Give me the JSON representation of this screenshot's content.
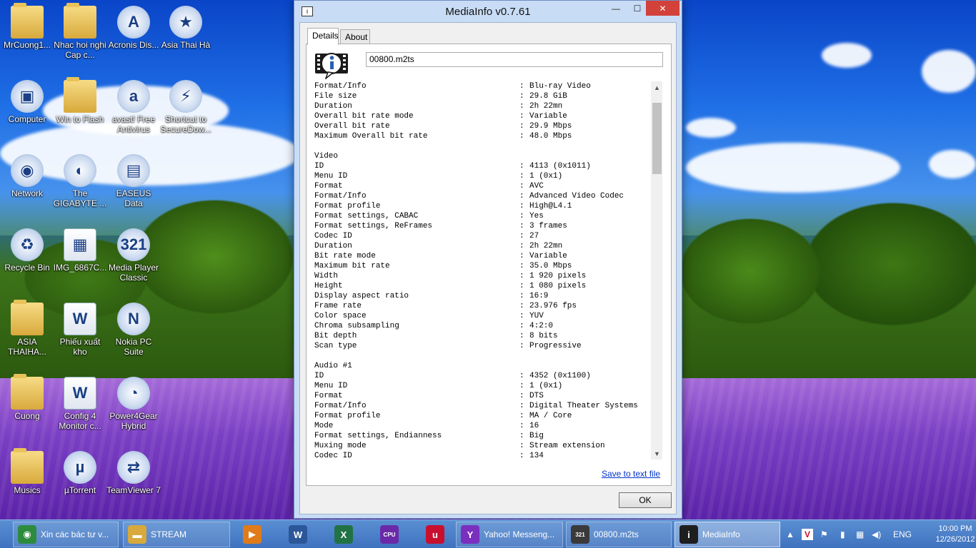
{
  "window": {
    "title": "MediaInfo v0.7.61",
    "tabs": [
      {
        "label": "Details"
      },
      {
        "label": "About"
      }
    ],
    "filename": "00800.m2ts",
    "save_link": "Save to text file",
    "ok_label": "OK",
    "controls": {
      "minimize": "—",
      "maximize": "☐",
      "close": "✕"
    }
  },
  "info": [
    {
      "k": "Format/Info",
      "v": "Blu-ray Video"
    },
    {
      "k": "File size",
      "v": "29.8 GiB"
    },
    {
      "k": "Duration",
      "v": "2h 22mn"
    },
    {
      "k": "Overall bit rate mode",
      "v": "Variable"
    },
    {
      "k": "Overall bit rate",
      "v": "29.9 Mbps"
    },
    {
      "k": "Maximum Overall bit rate",
      "v": "48.0 Mbps"
    },
    {
      "k": "",
      "v": ""
    },
    {
      "k": "Video",
      "v": null
    },
    {
      "k": "ID",
      "v": "4113 (0x1011)"
    },
    {
      "k": "Menu ID",
      "v": "1 (0x1)"
    },
    {
      "k": "Format",
      "v": "AVC"
    },
    {
      "k": "Format/Info",
      "v": "Advanced Video Codec"
    },
    {
      "k": "Format profile",
      "v": "High@L4.1"
    },
    {
      "k": "Format settings, CABAC",
      "v": "Yes"
    },
    {
      "k": "Format settings, ReFrames",
      "v": "3 frames"
    },
    {
      "k": "Codec ID",
      "v": "27"
    },
    {
      "k": "Duration",
      "v": "2h 22mn"
    },
    {
      "k": "Bit rate mode",
      "v": "Variable"
    },
    {
      "k": "Maximum bit rate",
      "v": "35.0 Mbps"
    },
    {
      "k": "Width",
      "v": "1 920 pixels"
    },
    {
      "k": "Height",
      "v": "1 080 pixels"
    },
    {
      "k": "Display aspect ratio",
      "v": "16:9"
    },
    {
      "k": "Frame rate",
      "v": "23.976 fps"
    },
    {
      "k": "Color space",
      "v": "YUV"
    },
    {
      "k": "Chroma subsampling",
      "v": "4:2:0"
    },
    {
      "k": "Bit depth",
      "v": "8 bits"
    },
    {
      "k": "Scan type",
      "v": "Progressive"
    },
    {
      "k": "",
      "v": ""
    },
    {
      "k": "Audio #1",
      "v": null
    },
    {
      "k": "ID",
      "v": "4352 (0x1100)"
    },
    {
      "k": "Menu ID",
      "v": "1 (0x1)"
    },
    {
      "k": "Format",
      "v": "DTS"
    },
    {
      "k": "Format/Info",
      "v": "Digital Theater Systems"
    },
    {
      "k": "Format profile",
      "v": "MA / Core"
    },
    {
      "k": "Mode",
      "v": "16"
    },
    {
      "k": "Format settings, Endianness",
      "v": "Big"
    },
    {
      "k": "Muxing mode",
      "v": "Stream extension"
    },
    {
      "k": "Codec ID",
      "v": "134"
    }
  ],
  "desktop_icons": [
    {
      "label": "MrCuong1...",
      "kind": "folder",
      "glyph": ""
    },
    {
      "label": "Nhac hoi nghi Cap c...",
      "kind": "folder",
      "glyph": ""
    },
    {
      "label": "Acronis Dis...",
      "kind": "app",
      "glyph": "A"
    },
    {
      "label": "Asia Thai Hà",
      "kind": "app",
      "glyph": "★"
    },
    {
      "label": "Computer",
      "kind": "app",
      "glyph": "▣"
    },
    {
      "label": "Win to Flash",
      "kind": "folder",
      "glyph": ""
    },
    {
      "label": "avast! Free Antivirus",
      "kind": "app",
      "glyph": "a"
    },
    {
      "label": "Shortcut to SecureDow...",
      "kind": "app",
      "glyph": "⚡"
    },
    {
      "label": "Network",
      "kind": "app",
      "glyph": "◉"
    },
    {
      "label": "The GIGABYTE ...",
      "kind": "app",
      "glyph": "◐"
    },
    {
      "label": "EASEUS Data Recovery ...",
      "kind": "app",
      "glyph": "▤"
    },
    {
      "label": "Recycle Bin",
      "kind": "app",
      "glyph": "♻"
    },
    {
      "label": "IMG_6867C...",
      "kind": "doc",
      "glyph": "▦"
    },
    {
      "label": "Media Player Classic",
      "kind": "app",
      "glyph": "321"
    },
    {
      "label": "ASIA THAIHA...",
      "kind": "folder",
      "glyph": ""
    },
    {
      "label": "Phiếu xuất kho",
      "kind": "doc",
      "glyph": "W"
    },
    {
      "label": "Nokia PC Suite",
      "kind": "app",
      "glyph": "N"
    },
    {
      "label": "Cuong",
      "kind": "folder",
      "glyph": ""
    },
    {
      "label": "Config 4 Monitor c...",
      "kind": "doc",
      "glyph": "W"
    },
    {
      "label": "Power4Gear Hybrid",
      "kind": "app",
      "glyph": "◔"
    },
    {
      "label": "Musics",
      "kind": "folder",
      "glyph": ""
    },
    {
      "label": "µTorrent",
      "kind": "app",
      "glyph": "µ"
    },
    {
      "label": "TeamViewer 7",
      "kind": "app",
      "glyph": "⇄"
    }
  ],
  "taskbar": {
    "items": [
      {
        "label": "Xin các bác tư v...",
        "icon": "chrome-icon",
        "color": "#2e8b3d",
        "glyph": "◉"
      },
      {
        "label": "STREAM",
        "icon": "folder-icon",
        "color": "#d8a93c",
        "glyph": "▬"
      },
      {
        "label": "",
        "icon": "media-player-icon",
        "color": "#e07b1a",
        "glyph": "▶"
      },
      {
        "label": "",
        "icon": "word-icon",
        "color": "#2b579a",
        "glyph": "W"
      },
      {
        "label": "",
        "icon": "excel-icon",
        "color": "#217346",
        "glyph": "X"
      },
      {
        "label": "",
        "icon": "cpuz-icon",
        "color": "#6a2aa8",
        "glyph": "CPU"
      },
      {
        "label": "",
        "icon": "unikey-icon",
        "color": "#c8102e",
        "glyph": "u"
      },
      {
        "label": "Yahoo! Messeng...",
        "icon": "yahoo-icon",
        "color": "#7b2fbe",
        "glyph": "Y"
      },
      {
        "label": "00800.m2ts",
        "icon": "mpc-icon",
        "color": "#3a3a3a",
        "glyph": "321"
      },
      {
        "label": "MediaInfo",
        "icon": "mediainfo-icon",
        "color": "#1e1e1e",
        "glyph": "i"
      }
    ],
    "tray": {
      "language": "ENG",
      "time": "10:00 PM",
      "date": "12/26/2012"
    }
  },
  "colors": {
    "window_frame": "#c9dcf5",
    "close_button": "#d2413a",
    "link": "#0033cc",
    "taskbar": "#3e72bf"
  }
}
